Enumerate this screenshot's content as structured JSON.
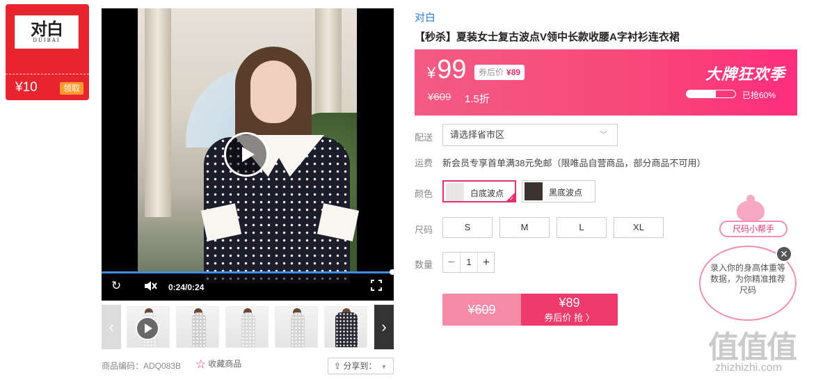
{
  "coupon": {
    "logo_text": "对白",
    "logo_sub": "DUIBAI",
    "amount": "¥10",
    "action": "领取"
  },
  "video": {
    "time": "0:24/0:24",
    "progress": 1.0
  },
  "thumbnails": [
    {
      "has_play": true
    },
    {
      "has_play": false
    },
    {
      "has_play": false
    },
    {
      "has_play": false
    },
    {
      "has_play": false
    }
  ],
  "meta": {
    "code_label": "商品编码：ADQ083B",
    "fav_label": "收藏商品",
    "share_label": "分享到："
  },
  "product": {
    "brand": "对白",
    "title": "【秒杀】夏装女士复古波点V领中长款收腰A字衬衫连衣裙",
    "price_yen": "¥",
    "price": "99",
    "after_coupon_label": "券后价",
    "after_coupon_price": "¥89",
    "original_price": "¥609",
    "discount": "1.5折",
    "slogan": "大牌狂欢季",
    "sold_text": "已抢60%",
    "sold_progress": 0.6
  },
  "delivery": {
    "label": "配送",
    "placeholder": "请选择省市区"
  },
  "shipping": {
    "label": "运费",
    "text": "新会员专享首单满38元免邮（限唯品自营商品，部分商品不可用）"
  },
  "colors": {
    "label": "颜色",
    "options": [
      "白底波点",
      "黑底波点"
    ],
    "selected": "白底波点"
  },
  "sizes": {
    "label": "尺码",
    "options": [
      "S",
      "M",
      "L",
      "XL"
    ]
  },
  "quantity": {
    "label": "数量",
    "value": "1",
    "minus": "−",
    "plus": "+"
  },
  "buy": {
    "original": "¥609",
    "price": "¥89",
    "action": "券后价 抢 〉"
  },
  "size_helper": {
    "title": "尺码小帮手",
    "text": "录入你的身高体重等数据，为你精准推荐尺码",
    "close": "✕"
  },
  "watermark": {
    "text": "值值值",
    "sub": "zhizhizhi.com"
  },
  "colors_theme": {
    "accent": "#e5306f",
    "banner": "#f7497a",
    "coupon": "#e8242f",
    "link": "#2b7bd6"
  }
}
